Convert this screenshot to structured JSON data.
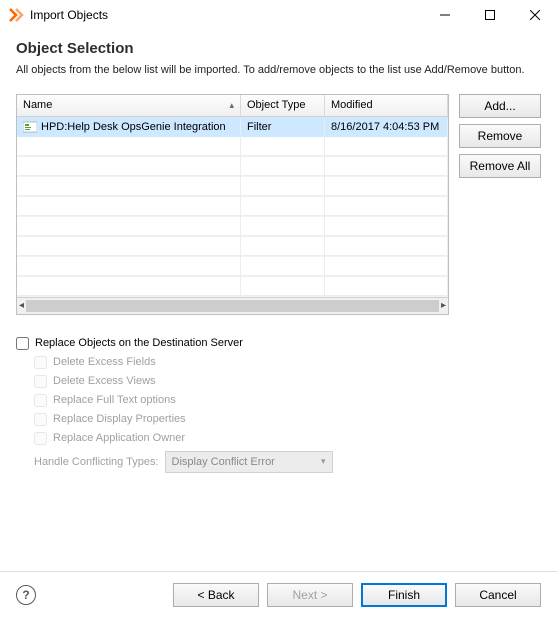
{
  "window": {
    "title": "Import Objects"
  },
  "heading": "Object Selection",
  "description": "All objects from the below list will be imported. To add/remove objects to the list use Add/Remove button.",
  "table": {
    "columns": {
      "name": "Name",
      "type": "Object Type",
      "modified": "Modified"
    },
    "rows": [
      {
        "name": "HPD:Help Desk OpsGenie Integration",
        "type": "Filter",
        "modified": "8/16/2017 4:04:53 PM"
      }
    ]
  },
  "buttons": {
    "add": "Add...",
    "remove": "Remove",
    "remove_all": "Remove All"
  },
  "options": {
    "replace_label": "Replace Objects on the Destination Server",
    "delete_fields": "Delete Excess Fields",
    "delete_views": "Delete Excess Views",
    "replace_fulltext": "Replace Full Text options",
    "replace_display": "Replace Display Properties",
    "replace_owner": "Replace Application Owner",
    "handle_label": "Handle Conflicting Types:",
    "handle_value": "Display Conflict Error"
  },
  "footer": {
    "back": "< Back",
    "next": "Next >",
    "finish": "Finish",
    "cancel": "Cancel"
  }
}
